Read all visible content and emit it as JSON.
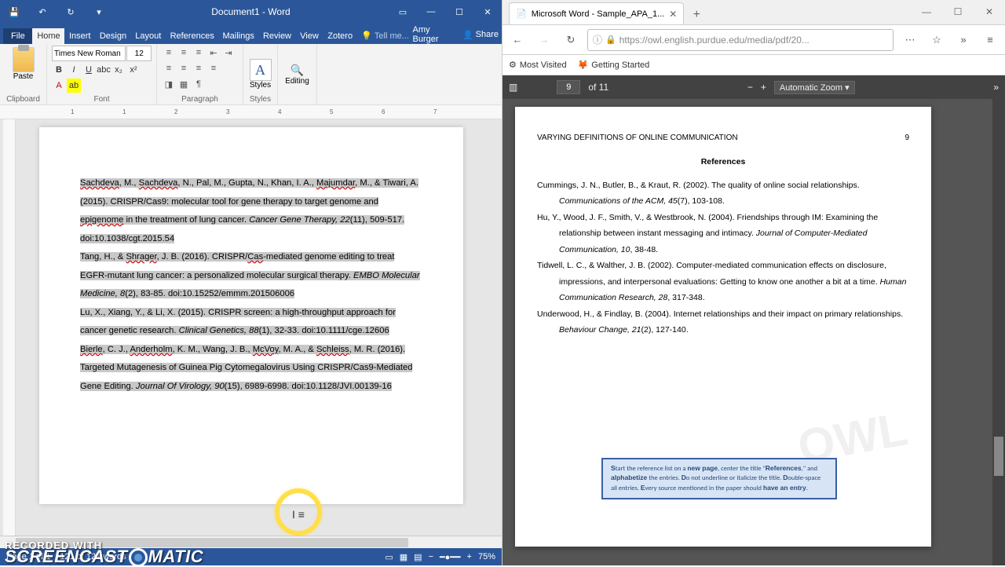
{
  "word": {
    "title": "Document1 - Word",
    "tabs": {
      "file": "File",
      "home": "Home",
      "insert": "Insert",
      "design": "Design",
      "layout": "Layout",
      "refer": "References",
      "mail": "Mailings",
      "review": "Review",
      "view": "View",
      "zotero": "Zotero",
      "tell": "Tell me...",
      "user": "Amy Burger",
      "share": "Share"
    },
    "font_name": "Times New Roman",
    "font_size": "12",
    "groups": {
      "clipboard": "Clipboard",
      "font": "Font",
      "paragraph": "Paragraph",
      "styles": "Styles",
      "paste": "Paste",
      "styles_btn": "Styles",
      "editing": "Editing"
    },
    "status": {
      "page": "Page 1 of 1",
      "words": "121 of 121 words",
      "zoom": "75%"
    },
    "doc_lines": [
      "Sachdeva, M., Sachdeva, N., Pal, M., Gupta, N., Khan, I. A., Majumdar, M., & Tiwari, A. (2015). CRISPR/Cas9: molecular tool for gene therapy to target genome and epigenome in the treatment of lung cancer. Cancer Gene Therapy, 22(11), 509-517. doi:10.1038/cgt.2015.54",
      "Tang, H., & Shrager, J. B. (2016). CRISPR/Cas-mediated genome editing to treat EGFR-mutant lung cancer: a personalized molecular surgical therapy. EMBO Molecular Medicine, 8(2), 83-85. doi:10.15252/emmm.201506006",
      "Lu, X., Xiang, Y., & Li, X. (2015). CRISPR screen: a high-throughput approach for cancer genetic research. Clinical Genetics, 88(1), 32-33. doi:10.1111/cge.12606",
      "Bierle, C. J., Anderholm, K. M., Wang, J. B., McVoy, M. A., & Schleiss, M. R. (2016). Targeted Mutagenesis of Guinea Pig Cytomegalovirus Using CRISPR/Cas9-Mediated Gene Editing. Journal Of Virology, 90(15), 6989-6998. doi:10.1128/JVI.00139-16"
    ]
  },
  "browser": {
    "tab_title": "Microsoft Word - Sample_APA_1...",
    "url": "https://owl.english.purdue.edu/media/pdf/20...",
    "bookmarks": {
      "most": "Most Visited",
      "getting": "Getting Started"
    },
    "pdf": {
      "page": "9",
      "total": "of 11",
      "zoom": "Automatic Zoom"
    },
    "header": "VARYING DEFINITIONS OF ONLINE COMMUNICATION",
    "pagenum": "9",
    "title": "References",
    "refs": [
      "Cummings, J. N., Butler, B., & Kraut, R. (2002). The quality of online social relationships. Communications of the ACM, 45(7), 103-108.",
      "Hu, Y., Wood, J. F., Smith, V., & Westbrook, N. (2004). Friendships through IM: Examining the relationship between instant messaging and intimacy. Journal of Computer-Mediated Communication, 10, 38-48.",
      "Tidwell, L. C., & Walther, J. B. (2002). Computer-mediated communication effects on disclosure, impressions, and interpersonal evaluations: Getting to know one another a bit at a time. Human Communication Research, 28, 317-348.",
      "Underwood, H., & Findlay, B. (2004). Internet relationships and their impact on primary relationships. Behaviour Change, 21(2), 127-140."
    ],
    "note": "Start the reference list on a new page, center the title \"References,\" and alphabetize the entries. Do not underline or italicize the title. Double-space all entries. Every source mentioned in the paper should have an entry."
  },
  "overlay": {
    "recorded": "RECORDED WITH",
    "brand_a": "SCREENCAST",
    "brand_b": "MATIC"
  }
}
